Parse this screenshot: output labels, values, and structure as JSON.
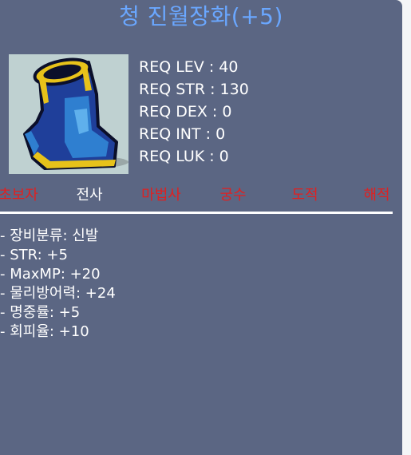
{
  "item": {
    "name": "청 진월장화(+5)",
    "icon": "blue-boots-icon"
  },
  "requirements": [
    "REQ LEV : 40",
    "REQ STR : 130",
    "REQ DEX : 0",
    "REQ INT : 0",
    "REQ LUK : 0"
  ],
  "jobs": [
    "초보자",
    "전사",
    "마법사",
    "궁수",
    "도적",
    "해적"
  ],
  "stats": [
    "- 장비분류: 신발",
    "- STR: +5",
    "- MaxMP: +20",
    "- 물리방어력: +24",
    "- 명중률: +5",
    "- 회피율: +10"
  ],
  "colors": {
    "panel_bg": "#5b6683",
    "title": "#6aa7ff",
    "job_unavailable": "#e02020",
    "job_available": "#ffffff",
    "text": "#ffffff",
    "icon_bg": "#bfd1d1"
  }
}
